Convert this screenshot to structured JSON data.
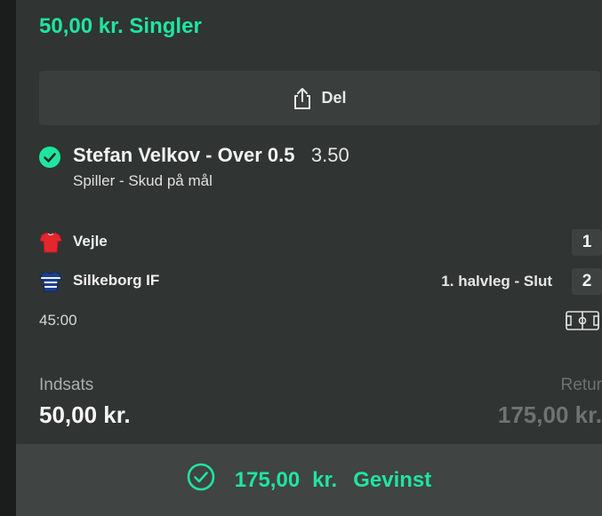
{
  "bet": {
    "title": "50,00 kr. Singler"
  },
  "share": {
    "label": "Del",
    "icon": "share-icon"
  },
  "selection": {
    "status_icon": "check-circle-icon",
    "name": "Stefan Velkov - Over 0.5",
    "odds": "3.50",
    "market": "Spiller - Skud på mål"
  },
  "match": {
    "home": {
      "name": "Vejle",
      "score": "1",
      "shirt_icon": "red-shirt-icon"
    },
    "away": {
      "name": "Silkeborg IF",
      "score": "2",
      "shirt_icon": "blue-striped-shirt-icon"
    },
    "period": "1. halvleg - Slut",
    "clock": "45:00",
    "pitch_icon": "pitch-icon"
  },
  "stake": {
    "label": "Indsats",
    "value": "50,00 kr."
  },
  "return": {
    "label": "Retur",
    "value": "175,00 kr."
  },
  "win": {
    "icon": "check-circle-outline-icon",
    "amount": "175,00",
    "currency": "kr.",
    "label": "Gevinst"
  },
  "colors": {
    "accent": "#1fe5a0",
    "card": "#303433",
    "background": "#1d2120"
  }
}
